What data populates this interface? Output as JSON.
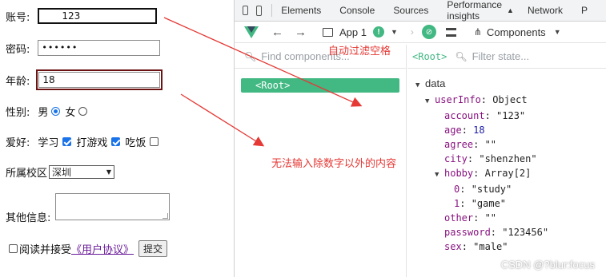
{
  "form": {
    "account_label": "账号:",
    "account_value": "123",
    "password_label": "密码:",
    "password_value": "••••••",
    "age_label": "年龄:",
    "age_value": "18",
    "gender_label": "性别:",
    "gender_male": "男",
    "gender_female": "女",
    "hobby_label": "爱好:",
    "hobby_study": "学习",
    "hobby_game": "打游戏",
    "hobby_eat": "吃饭",
    "campus_label": "所属校区",
    "campus_value": "深圳",
    "other_label": "其他信息:",
    "agree_text": "阅读并接受",
    "agree_link": "《用户协议》",
    "submit_label": "提交"
  },
  "devtools": {
    "tabs": [
      "Elements",
      "Console",
      "Sources",
      "Performance insights",
      "Network",
      "P"
    ],
    "app_label": "App 1",
    "components_label": "Components",
    "find_placeholder": "Find components...",
    "root_component": "<Root>",
    "root_tag": "<Root>",
    "filter_placeholder": "Filter state...",
    "data_section": "data",
    "tree": [
      {
        "indent": 1,
        "toggle": "▼",
        "key": "userInfo",
        "value": "Object"
      },
      {
        "indent": 2,
        "toggle": "",
        "key": "account",
        "value": "\"123\""
      },
      {
        "indent": 2,
        "toggle": "",
        "key": "age",
        "value": "18"
      },
      {
        "indent": 2,
        "toggle": "",
        "key": "agree",
        "value": "\"\""
      },
      {
        "indent": 2,
        "toggle": "",
        "key": "city",
        "value": "\"shenzhen\""
      },
      {
        "indent": 2,
        "toggle": "▼",
        "key": "hobby",
        "value": "Array[2]"
      },
      {
        "indent": 3,
        "toggle": "",
        "key": "0",
        "value": "\"study\""
      },
      {
        "indent": 3,
        "toggle": "",
        "key": "1",
        "value": "\"game\""
      },
      {
        "indent": 2,
        "toggle": "",
        "key": "other",
        "value": "\"\""
      },
      {
        "indent": 2,
        "toggle": "",
        "key": "password",
        "value": "\"123456\""
      },
      {
        "indent": 2,
        "toggle": "",
        "key": "sex",
        "value": "\"male\""
      }
    ]
  },
  "annotations": {
    "trim_note": "自动过滤空格",
    "number_note": "无法输入除数字以外的内容",
    "color": "#e53935"
  },
  "watermark": "CSDN @?blur:focus"
}
